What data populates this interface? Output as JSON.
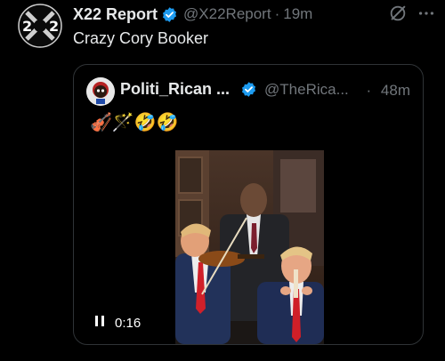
{
  "post": {
    "author_name": "X22 Report",
    "author_handle": "@X22Report",
    "separator": "·",
    "time": "19m",
    "text": "Crazy Cory Booker",
    "avatar_text": "X22"
  },
  "quote": {
    "author_name": "Politi_Rican ...",
    "author_handle": "@TheRica...",
    "separator": "·",
    "time": "48m",
    "emojis": "🎻🪄🤣🤣",
    "video": {
      "time": "0:16"
    }
  },
  "colors": {
    "background": "#000000",
    "text_primary": "#e7e9ea",
    "text_secondary": "#71767b",
    "verified_blue": "#1d9bf0",
    "border": "#2f3336"
  },
  "icons": {
    "verified": "verified-badge-icon",
    "grok": "grok-icon",
    "more": "more-options-icon",
    "pause": "pause-icon"
  }
}
